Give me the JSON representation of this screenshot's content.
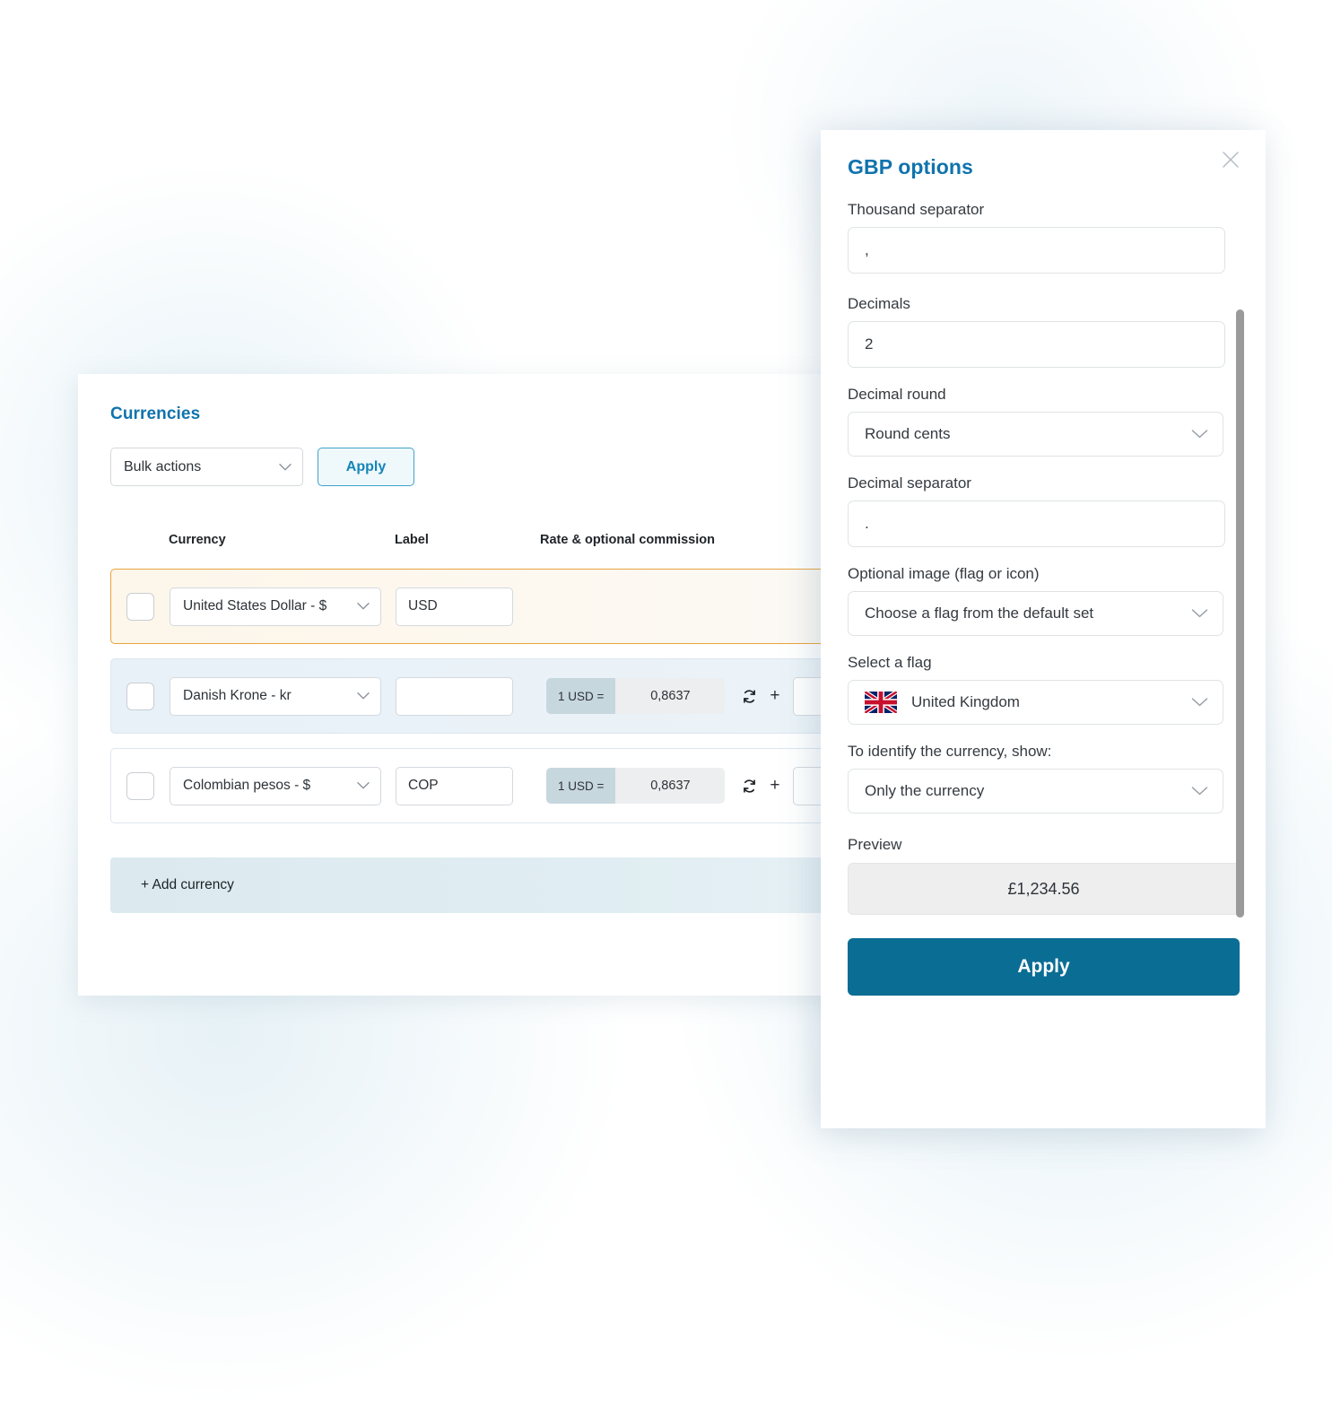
{
  "left_panel": {
    "title": "Currencies",
    "bulk_actions": {
      "selected": "Bulk actions",
      "apply_label": "Apply"
    },
    "table_headers": {
      "currency": "Currency",
      "label": "Label",
      "rate": "Rate & optional commission"
    },
    "rows": [
      {
        "currency": "United States Dollar - $",
        "label": "USD",
        "rate_prefix": "",
        "rate_value": "",
        "plus": "",
        "state": "highlight"
      },
      {
        "currency": "Danish Krone - kr",
        "label": "",
        "rate_prefix": "1 USD =",
        "rate_value": "0,8637",
        "plus": "+",
        "state": "selected"
      },
      {
        "currency": "Colombian pesos - $",
        "label": "COP",
        "rate_prefix": "1 USD =",
        "rate_value": "0,8637",
        "plus": "+",
        "state": "plain"
      }
    ],
    "add_currency_label": "+ Add currency"
  },
  "modal": {
    "title": "GBP options",
    "close_icon": "close-icon",
    "fields": {
      "thousand_separator": {
        "label": "Thousand separator",
        "value": ","
      },
      "decimals": {
        "label": "Decimals",
        "value": "2"
      },
      "decimal_round": {
        "label": "Decimal round",
        "value": "Round cents"
      },
      "decimal_separator": {
        "label": "Decimal separator",
        "value": "."
      },
      "optional_image": {
        "label": "Optional image (flag or icon)",
        "value": "Choose a flag from the default set"
      },
      "select_flag": {
        "label": "Select a flag",
        "value": "United Kingdom",
        "flag": "united-kingdom-flag"
      },
      "identify_currency": {
        "label": "To identify the currency, show:",
        "value": "Only the currency"
      }
    },
    "preview": {
      "label": "Preview",
      "value": "£1,234.56"
    },
    "apply_label": "Apply"
  },
  "colors": {
    "brand_blue": "#1073ad",
    "apply_primary": "#0a6d94",
    "highlight_border": "#e8a33d",
    "selected_row": "#e8f1f8"
  }
}
